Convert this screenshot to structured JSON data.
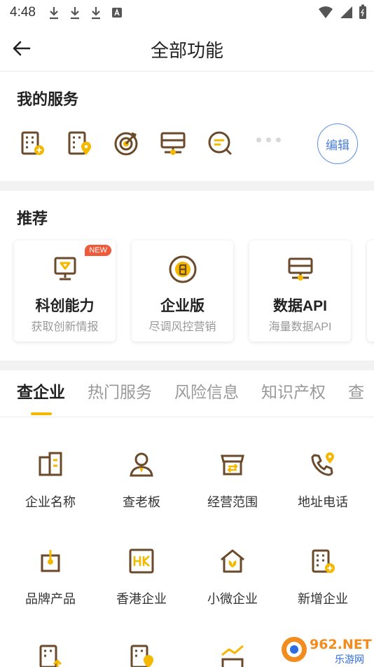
{
  "status_bar": {
    "time": "4:48"
  },
  "header": {
    "title": "全部功能"
  },
  "my_services": {
    "title": "我的服务",
    "icons": [
      "building-add-icon",
      "building-location-icon",
      "target-icon",
      "monitor-icon",
      "chat-search-icon"
    ],
    "edit_label": "编辑"
  },
  "recommend": {
    "title": "推荐",
    "cards": [
      {
        "title": "科创能力",
        "subtitle": "获取创新情报",
        "badge": "NEW",
        "icon": "easel-icon"
      },
      {
        "title": "企业版",
        "subtitle": "尽调风控营销",
        "icon": "enterprise-seal-icon"
      },
      {
        "title": "数据API",
        "subtitle": "海量数据API",
        "icon": "server-icon"
      }
    ]
  },
  "tabs": [
    "查企业",
    "热门服务",
    "风险信息",
    "知识产权",
    "查"
  ],
  "active_tab": 0,
  "grid": [
    {
      "label": "企业名称",
      "icon": "building-icon"
    },
    {
      "label": "查老板",
      "icon": "person-icon"
    },
    {
      "label": "经营范围",
      "icon": "store-icon"
    },
    {
      "label": "地址电话",
      "icon": "phone-location-icon"
    },
    {
      "label": "品牌产品",
      "icon": "brand-product-icon"
    },
    {
      "label": "香港企业",
      "icon": "hk-icon"
    },
    {
      "label": "小微企业",
      "icon": "small-house-icon"
    },
    {
      "label": "新增企业",
      "icon": "building-add-icon"
    }
  ],
  "watermark": {
    "text": "962.NET",
    "sub": "乐游网"
  },
  "colors": {
    "accent": "#f5b800",
    "icon_brown": "#6b4a2b",
    "link_blue": "#4a7fd9",
    "badge_red": "#ee5a3c"
  }
}
